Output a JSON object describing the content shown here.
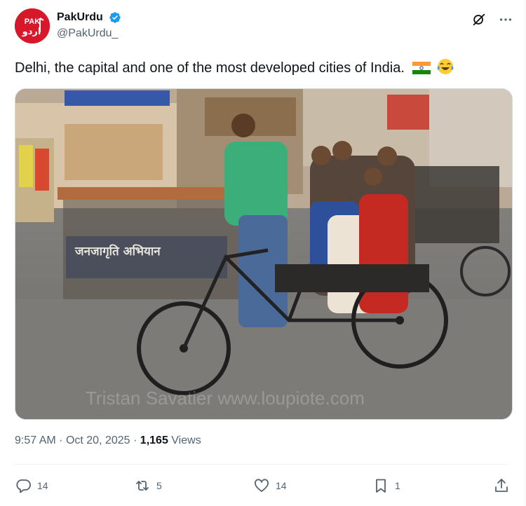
{
  "author": {
    "display_name": "PakUrdu",
    "handle": "@PakUrdu_",
    "avatar_text": "PAK اردو",
    "verified": true
  },
  "tweet": {
    "text": "Delhi, the capital and one of the most developed cities of India."
  },
  "photo": {
    "sign_text": "जनजागृति अभियान",
    "watermark": "Tristan Savatier   www.loupiote.com"
  },
  "meta": {
    "time": "9:57 AM",
    "date": "Oct 20, 2025",
    "views": "1,165",
    "views_label": "Views"
  },
  "actions": {
    "replies": "14",
    "reposts": "5",
    "likes": "14",
    "bookmarks": "1"
  },
  "colors": {
    "verified": "#1d9bf0",
    "muted": "#536471",
    "avatar": "#d7182a"
  }
}
